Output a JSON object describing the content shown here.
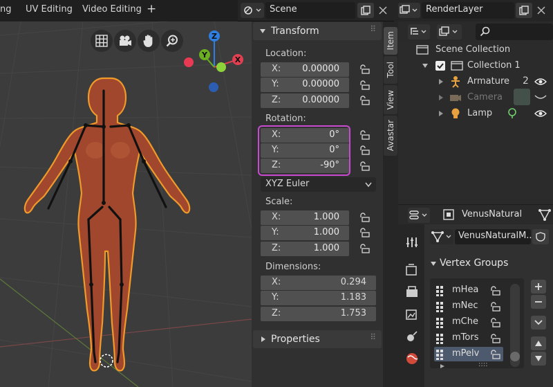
{
  "workspace_tabs": [
    "ng",
    "UV Editing",
    "Video Editing"
  ],
  "add_tab_label": "+",
  "scene": {
    "name": "Scene"
  },
  "render_layer": {
    "name": "RenderLayer"
  },
  "npanel": {
    "transform_title": "Transform",
    "location_label": "Location:",
    "location": [
      {
        "axis": "X:",
        "value": "0.00000"
      },
      {
        "axis": "Y:",
        "value": "0.00000"
      },
      {
        "axis": "Z:",
        "value": "0.00000"
      }
    ],
    "rotation_label": "Rotation:",
    "rotation": [
      {
        "axis": "X:",
        "value": "0°"
      },
      {
        "axis": "Y:",
        "value": "0°"
      },
      {
        "axis": "Z:",
        "value": "-90°"
      }
    ],
    "rotation_mode": "XYZ Euler",
    "scale_label": "Scale:",
    "scale": [
      {
        "axis": "X:",
        "value": "1.000"
      },
      {
        "axis": "Y:",
        "value": "1.000"
      },
      {
        "axis": "Z:",
        "value": "1.000"
      }
    ],
    "dimensions_label": "Dimensions:",
    "dimensions": [
      {
        "axis": "X:",
        "value": "0.294"
      },
      {
        "axis": "Y:",
        "value": "1.183"
      },
      {
        "axis": "Z:",
        "value": "1.753"
      }
    ],
    "properties_title": "Properties"
  },
  "side_tabs": [
    "Item",
    "Tool",
    "View",
    "Avastar"
  ],
  "gizmo": {
    "z": "Z",
    "y": "Y",
    "x": "X"
  },
  "outliner": {
    "scene_collection": "Scene Collection",
    "collection": "Collection 1",
    "items": [
      "Armature",
      "Camera",
      "Lamp"
    ],
    "armature_count": "2"
  },
  "properties": {
    "object_name": "VenusNatural",
    "mesh_name": "VenusNaturalM...",
    "vertex_groups_title": "Vertex Groups",
    "vertex_groups": [
      "mHea",
      "mNec",
      "mChe",
      "mTors",
      "mPelv"
    ],
    "grip": "::::"
  },
  "colors": {
    "selection_highlight": "#c84bd0",
    "accent_orange": "#f09a2a",
    "bone_black": "#111111"
  }
}
